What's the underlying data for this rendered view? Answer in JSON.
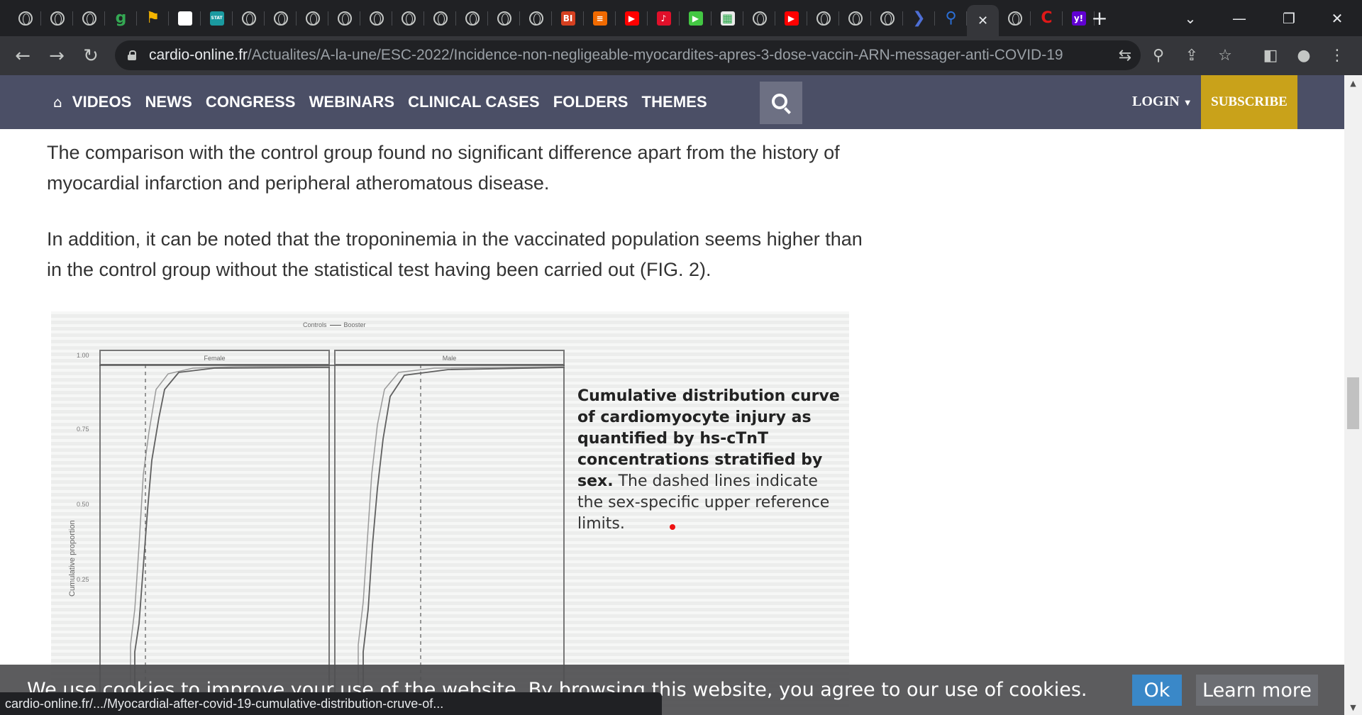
{
  "browser": {
    "tabs": [
      {
        "icon": "globe-icon"
      },
      {
        "icon": "globe-icon"
      },
      {
        "icon": "globe-icon"
      },
      {
        "icon": "g-icon",
        "glyph": "g",
        "color": "#34a853"
      },
      {
        "icon": "flag-icon",
        "glyph": "⚑",
        "color": "#f4b400"
      },
      {
        "icon": "white-square-icon",
        "glyph": "",
        "color": "#ffffff"
      },
      {
        "icon": "stat-icon",
        "glyph": "STAT",
        "color": "#1a9aa0"
      },
      {
        "icon": "globe-icon"
      },
      {
        "icon": "globe-icon"
      },
      {
        "icon": "globe-icon"
      },
      {
        "icon": "globe-icon"
      },
      {
        "icon": "globe-icon"
      },
      {
        "icon": "globe-icon"
      },
      {
        "icon": "globe-icon"
      },
      {
        "icon": "globe-icon"
      },
      {
        "icon": "globe-icon"
      },
      {
        "icon": "globe-icon"
      },
      {
        "icon": "bi-icon",
        "glyph": "BI",
        "color": "#d64020"
      },
      {
        "icon": "bookmark-icon",
        "glyph": "≡",
        "color": "#f06a00"
      },
      {
        "icon": "youtube-icon",
        "glyph": "▶",
        "color": "#ff0000"
      },
      {
        "icon": "mic-icon",
        "glyph": "♪",
        "color": "#e0102a"
      },
      {
        "icon": "play-icon",
        "glyph": "▶",
        "color": "#43c743"
      },
      {
        "icon": "image-icon",
        "glyph": "▦",
        "color": "#eaeaea"
      },
      {
        "icon": "globe-icon"
      },
      {
        "icon": "youtube-icon",
        "glyph": "▶",
        "color": "#ff0000"
      },
      {
        "icon": "globe-icon"
      },
      {
        "icon": "globe-icon"
      },
      {
        "icon": "globe-icon"
      },
      {
        "icon": "arrow-icon",
        "glyph": "❯",
        "color": "#4e6fd6"
      },
      {
        "icon": "search-icon",
        "glyph": "⚲",
        "color": "#2b6fd6"
      },
      {
        "icon": "close-icon",
        "glyph": "✕",
        "color": "#e8eaed",
        "active": true
      },
      {
        "icon": "globe-icon"
      },
      {
        "icon": "c-icon",
        "glyph": "C",
        "color": "#e01818"
      },
      {
        "icon": "yahoo-icon",
        "glyph": "y!",
        "color": "#6001d2"
      }
    ],
    "url_host": "cardio-online.fr",
    "url_path": "/Actualites/A-la-une/ESC-2022/Incidence-non-negligeable-myocardites-apres-3-dose-vaccin-ARN-messager-anti-COVID-19",
    "status_url": "cardio-online.fr/.../Myocardial-after-covid-19-cumulative-distribution-cruve-of..."
  },
  "sitenav": {
    "items": [
      "VIDEOS",
      "NEWS",
      "CONGRESS",
      "WEBINARS",
      "CLINICAL CASES",
      "FOLDERS",
      "THEMES"
    ],
    "login": "LOGIN",
    "subscribe": "SUBSCRIBE"
  },
  "article": {
    "para1": "The comparison with the control group found no significant difference apart from the history of myocardial infarction and peripheral atheromatous disease.",
    "para2": "In addition, it can be noted that the troponinemia in the vaccinated population seems higher than in the control group without the statistical test having been carried out (FIG. 2)."
  },
  "figure": {
    "legend_controls": "Controls",
    "legend_booster": "Booster",
    "panel_female": "Female",
    "panel_male": "Male",
    "yticks": [
      "1.00",
      "0.75",
      "0.50",
      "0.25"
    ],
    "ylabel": "Cumulative proportion",
    "caption_bold": "Cumulative distribution curve of cardiomyocyte injury as quantified by hs-cTnT concentrations stratified by sex.",
    "caption_normal": "The dashed lines indicate the sex-specific upper reference limits."
  },
  "cookie": {
    "text": "We use cookies to improve your use of the website. By browsing this website, you agree to our use of cookies.",
    "ok": "Ok",
    "learn_more": "Learn more"
  }
}
